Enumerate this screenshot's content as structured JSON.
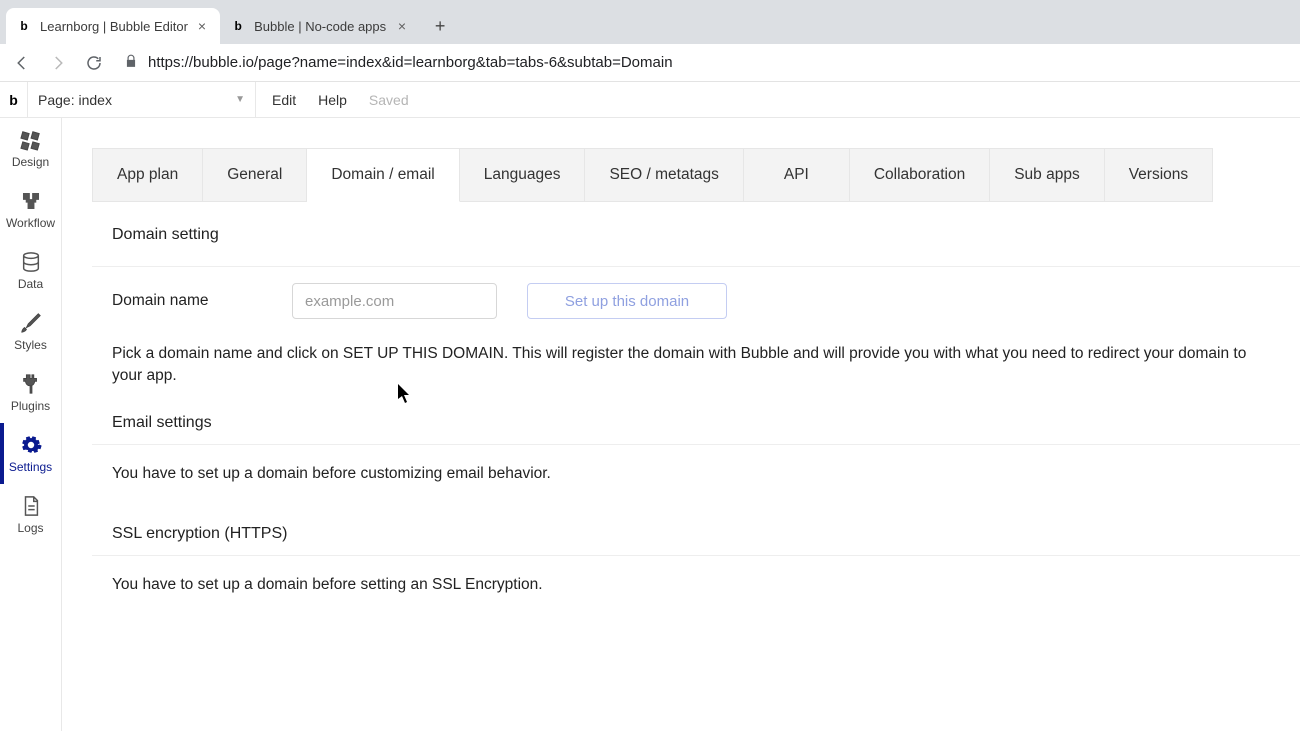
{
  "browser": {
    "tabs": [
      {
        "title": "Learnborg | Bubble Editor",
        "active": true
      },
      {
        "title": "Bubble | No-code apps",
        "active": false
      }
    ],
    "url": "https://bubble.io/page?name=index&id=learnborg&tab=tabs-6&subtab=Domain"
  },
  "editor": {
    "page_selector": "Page: index",
    "menu": {
      "edit": "Edit",
      "help": "Help",
      "saved": "Saved"
    }
  },
  "rail": {
    "items": [
      {
        "key": "design",
        "label": "Design"
      },
      {
        "key": "workflow",
        "label": "Workflow"
      },
      {
        "key": "data",
        "label": "Data"
      },
      {
        "key": "styles",
        "label": "Styles"
      },
      {
        "key": "plugins",
        "label": "Plugins"
      },
      {
        "key": "settings",
        "label": "Settings",
        "active": true
      },
      {
        "key": "logs",
        "label": "Logs"
      }
    ]
  },
  "settings_tabs": {
    "items": [
      {
        "key": "appplan",
        "label": "App plan"
      },
      {
        "key": "general",
        "label": "General"
      },
      {
        "key": "domain",
        "label": "Domain / email",
        "active": true
      },
      {
        "key": "languages",
        "label": "Languages"
      },
      {
        "key": "seo",
        "label": "SEO / metatags"
      },
      {
        "key": "api",
        "label": "API"
      },
      {
        "key": "collab",
        "label": "Collaboration"
      },
      {
        "key": "subapps",
        "label": "Sub apps"
      },
      {
        "key": "versions",
        "label": "Versions"
      }
    ]
  },
  "domain": {
    "section_title": "Domain setting",
    "row_label": "Domain name",
    "placeholder": "example.com",
    "value": "",
    "button": "Set up this domain",
    "description": "Pick a domain name and click on SET UP THIS DOMAIN. This will register the domain with Bubble and will provide you with what you need to redirect your domain to your app."
  },
  "email": {
    "section_title": "Email settings",
    "description": "You have to set up a domain before customizing email behavior."
  },
  "ssl": {
    "section_title": "SSL encryption (HTTPS)",
    "description": "You have to set up a domain before setting an SSL Encryption."
  }
}
